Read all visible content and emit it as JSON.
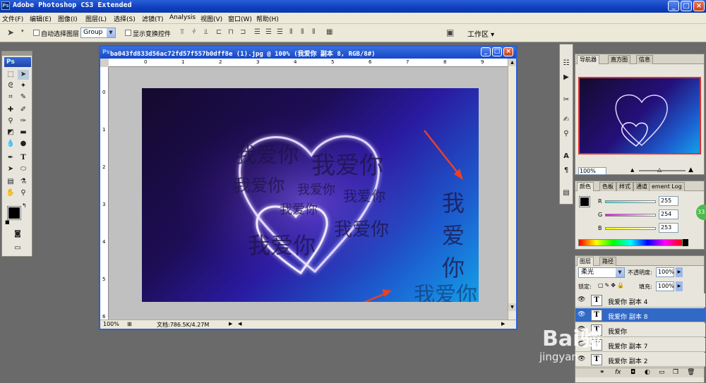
{
  "app": {
    "title": "Adobe Photoshop CS3 Extended",
    "logo": "Ps"
  },
  "menu": [
    "文件(F)",
    "编辑(E)",
    "图像(I)",
    "图层(L)",
    "选择(S)",
    "滤镜(T)",
    "Analysis",
    "视图(V)",
    "窗口(W)",
    "帮助(H)"
  ],
  "options": {
    "auto_select_label": "自动选择图层",
    "group_value": "Group",
    "show_transform_label": "显示变换控件",
    "workspace_label": "工作区"
  },
  "toolbox": {
    "logo": "Ps"
  },
  "document": {
    "title": "ba043fd833d56ac72fd57f557b0dff8e (1).jpg @ 100% (我爱你 副本 8, RGB/8#)",
    "zoom": "100%",
    "doc_info": "文档:786.5K/4.27M",
    "ruler_h": [
      "0",
      "1",
      "2",
      "3",
      "4",
      "5",
      "6",
      "7",
      "8",
      "9"
    ],
    "ruler_v": [
      "0",
      "1",
      "2",
      "3",
      "4",
      "5",
      "6"
    ],
    "overlay_text": "我爱你"
  },
  "navigator": {
    "tabs": [
      "导航器",
      "直方图",
      "信息"
    ],
    "zoom": "100%"
  },
  "color_panel": {
    "tabs": [
      "颜色",
      "色板",
      "样式",
      "通道",
      "ement Log"
    ],
    "r_label": "R",
    "g_label": "G",
    "b_label": "B",
    "r": "255",
    "g": "254",
    "b": "253"
  },
  "layers_panel": {
    "tabs": [
      "图层",
      "路径"
    ],
    "blend_mode": "柔光",
    "opacity_label": "不透明度:",
    "opacity": "100%",
    "lock_label": "锁定:",
    "fill_label": "填充:",
    "fill": "100%",
    "layers": [
      {
        "name": "我爱你 副本 4"
      },
      {
        "name": "我爱你 副本 8"
      },
      {
        "name": "我爱你"
      },
      {
        "name": "我爱你 副本 7"
      },
      {
        "name": "我爱你 副本 2"
      }
    ]
  },
  "badge": "33",
  "watermark": {
    "brand": "Bai验",
    "url": "jingyan"
  }
}
